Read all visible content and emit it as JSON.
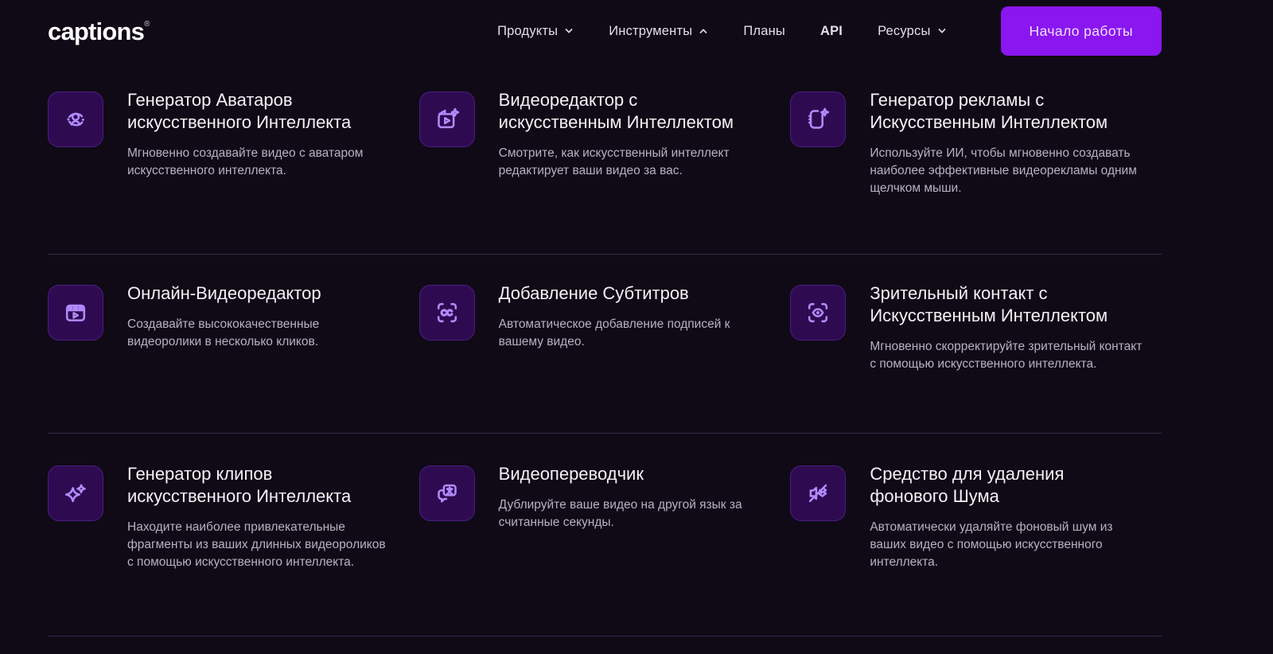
{
  "page": {
    "background_color": "#0f0a16",
    "divider_color": "#352c49",
    "accent_color": "#8a16f0"
  },
  "header": {
    "logo": {
      "text": "captions",
      "registered_mark": "®"
    },
    "nav": {
      "items": [
        {
          "label": "Продукты",
          "chevron": "down"
        },
        {
          "label": "Инструменты",
          "chevron": "up"
        },
        {
          "label": "Планы",
          "chevron": "none"
        },
        {
          "label": "API",
          "chevron": "none"
        },
        {
          "label": "Ресурсы",
          "chevron": "down"
        }
      ]
    },
    "cta": {
      "label": "Начало работы",
      "background": "#8a16f0",
      "text_color": "#f0e2ff"
    }
  },
  "tools_grid": {
    "icon_tile": {
      "background": "#2e0b51",
      "border": "#4c1b85",
      "glyph_color": "#b18bfa"
    },
    "cards": [
      {
        "icon": "ai-avatar-generator-icon",
        "title": "Генератор Аватаров\nискусственного Интеллекта",
        "description": "Мгновенно создавайте видео с аватаром искусственного интеллекта."
      },
      {
        "icon": "ai-video-editor-icon",
        "title": "Видеоредактор с\nискусственным Интеллектом",
        "description": "Смотрите, как искусственный интеллект редактирует ваши видео за вас."
      },
      {
        "icon": "ai-ads-generator-icon",
        "title": "Генератор рекламы с\nИскусственным Интеллектом",
        "description": "Используйте ИИ, чтобы мгновенно создавать\nнаиболее эффективные видеорекламы одним щелчком мыши."
      },
      {
        "icon": "online-video-editor-icon",
        "title": "Онлайн-Видеоредактор",
        "description": "Создавайте высококачественные видеоролики в несколько кликов."
      },
      {
        "icon": "captions-cc-icon",
        "title": "Добавление Субтитров",
        "description": "Автоматическое добавление подписей к вашему видео."
      },
      {
        "icon": "ai-eye-contact-icon",
        "title": "Зрительный контакт с\nИскусственным Интеллектом",
        "description": "Мгновенно скорректируйте зрительный контакт с помощью искусственного интеллекта."
      },
      {
        "icon": "ai-clip-generator-icon",
        "title": "Генератор клипов\nискусственного Интеллекта",
        "description": "Находите наиболее привлекательные фрагменты из ваших длинных видеороликов с помощью искусственного интеллекта."
      },
      {
        "icon": "video-translator-icon",
        "title": "Видеопереводчик",
        "description": "Дублируйте ваше видео на другой язык за считанные секунды."
      },
      {
        "icon": "background-noise-remover-icon",
        "title": "Средство для удаления\nфонового Шума",
        "description": "Автоматически удаляйте фоновый шум из ваших видео с помощью искусственного интеллекта."
      }
    ]
  }
}
